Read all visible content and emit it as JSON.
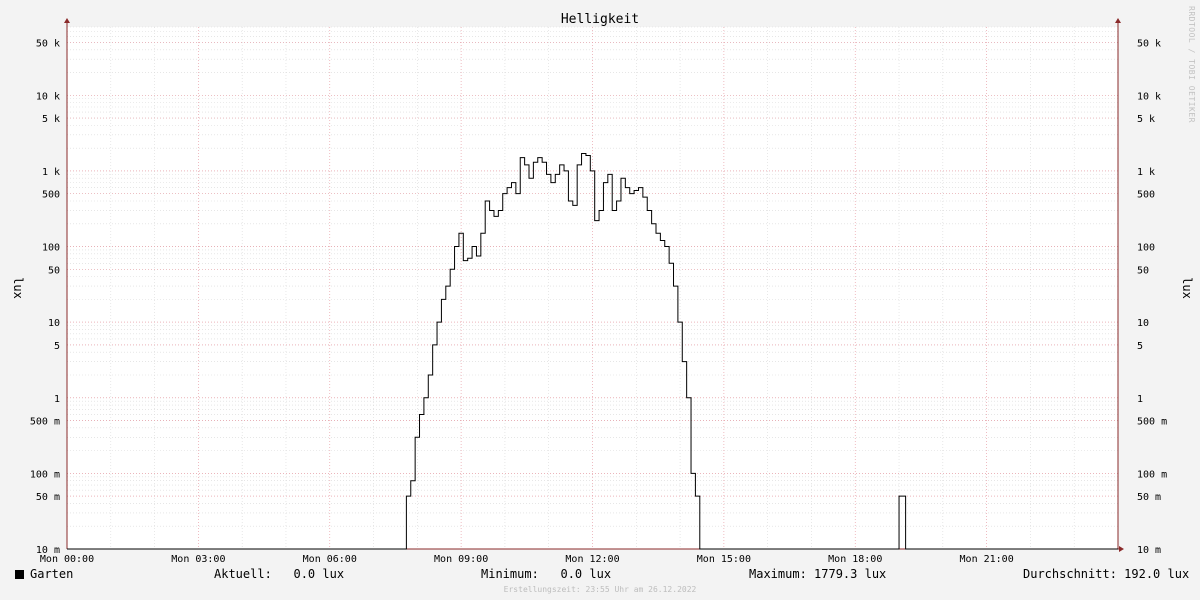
{
  "chart_data": {
    "type": "line",
    "title": "Helligkeit",
    "ylabel": "lux",
    "yscale": "log",
    "ylim": [
      0.01,
      80000
    ],
    "xlim": [
      "00:00",
      "24:00"
    ],
    "x_tick_labels": [
      "Mon 00:00",
      "Mon 03:00",
      "Mon 06:00",
      "Mon 09:00",
      "Mon 12:00",
      "Mon 15:00",
      "Mon 18:00",
      "Mon 21:00"
    ],
    "y_ticks": [
      {
        "value": 0.01,
        "label": "10 m"
      },
      {
        "value": 0.05,
        "label": "50 m"
      },
      {
        "value": 0.1,
        "label": "100 m"
      },
      {
        "value": 0.5,
        "label": "500 m"
      },
      {
        "value": 1,
        "label": "1"
      },
      {
        "value": 5,
        "label": "5"
      },
      {
        "value": 10,
        "label": "10"
      },
      {
        "value": 50,
        "label": "50"
      },
      {
        "value": 100,
        "label": "100"
      },
      {
        "value": 500,
        "label": "500"
      },
      {
        "value": 1000,
        "label": "1 k"
      },
      {
        "value": 5000,
        "label": "5 k"
      },
      {
        "value": 10000,
        "label": "10 k"
      },
      {
        "value": 50000,
        "label": "50 k"
      }
    ],
    "grid": true,
    "legend_position": "bottom",
    "series": [
      {
        "name": "Garten",
        "color": "#000000",
        "x_hours": [
          0,
          7.75,
          7.85,
          7.95,
          8.05,
          8.15,
          8.25,
          8.35,
          8.45,
          8.55,
          8.65,
          8.75,
          8.85,
          8.95,
          9.05,
          9.15,
          9.25,
          9.35,
          9.45,
          9.55,
          9.65,
          9.75,
          9.85,
          9.95,
          10.05,
          10.15,
          10.25,
          10.35,
          10.45,
          10.55,
          10.65,
          10.75,
          10.85,
          10.95,
          11.05,
          11.15,
          11.25,
          11.35,
          11.45,
          11.55,
          11.65,
          11.75,
          11.85,
          11.95,
          12.05,
          12.15,
          12.25,
          12.35,
          12.45,
          12.55,
          12.65,
          12.75,
          12.85,
          12.95,
          13.05,
          13.15,
          13.25,
          13.35,
          13.45,
          13.55,
          13.65,
          13.75,
          13.85,
          13.95,
          14.05,
          14.15,
          14.25,
          14.35,
          14.45,
          14.55,
          14.65,
          14.75,
          14.85,
          14.95,
          15.05,
          15.15,
          15.25,
          15.35,
          15.45,
          15.55,
          15.65,
          15.75,
          15.85,
          15.95,
          16.05,
          16.15,
          16.25,
          16.35,
          16.45,
          16.55,
          16.65,
          16.75,
          16.85,
          16.95,
          17.05,
          17.15,
          17.25,
          17.35,
          17.45,
          17.55,
          17.65,
          19.0,
          19.15,
          24
        ],
        "values": [
          0.01,
          0.05,
          0.08,
          0.3,
          0.6,
          1.0,
          2.0,
          5.0,
          10,
          20,
          30,
          50,
          100,
          150,
          65,
          70,
          100,
          75,
          150,
          400,
          300,
          250,
          300,
          500,
          600,
          700,
          500,
          1500,
          1200,
          800,
          1300,
          1500,
          1300,
          900,
          700,
          900,
          1200,
          1000,
          400,
          350,
          1200,
          1700,
          1600,
          1000,
          220,
          300,
          700,
          900,
          300,
          400,
          800,
          600,
          500,
          550,
          600,
          450,
          300,
          200,
          150,
          120,
          100,
          60,
          30,
          10,
          3,
          1,
          0.1,
          0.05,
          0.01,
          0.01,
          0.01,
          0.01,
          0.01,
          0.01,
          0.01,
          0.01,
          0.01,
          0.01,
          0.01,
          0.01,
          0.01,
          0.01,
          0.01,
          0.01,
          0.01,
          0.01,
          0.01,
          0.01,
          0.01,
          0.01,
          0.01,
          0.01,
          0.01,
          0.01,
          0.01,
          0.01,
          0.01,
          0.01,
          0.01,
          0.01,
          0.01,
          0.05,
          0.01,
          0.01
        ]
      }
    ]
  },
  "legend": {
    "series_name": "Garten",
    "aktuell": "Aktuell:   0.0 lux",
    "minimum": "Minimum:   0.0 lux",
    "maximum": "Maximum: 1779.3 lux",
    "durchschnitt": "Durchschnitt: 192.0 lux"
  },
  "footer": "Erstellungszeit: 23:55 Uhr am 26.12.2022",
  "watermark": "RRDTOOL / TOBI OETIKER"
}
